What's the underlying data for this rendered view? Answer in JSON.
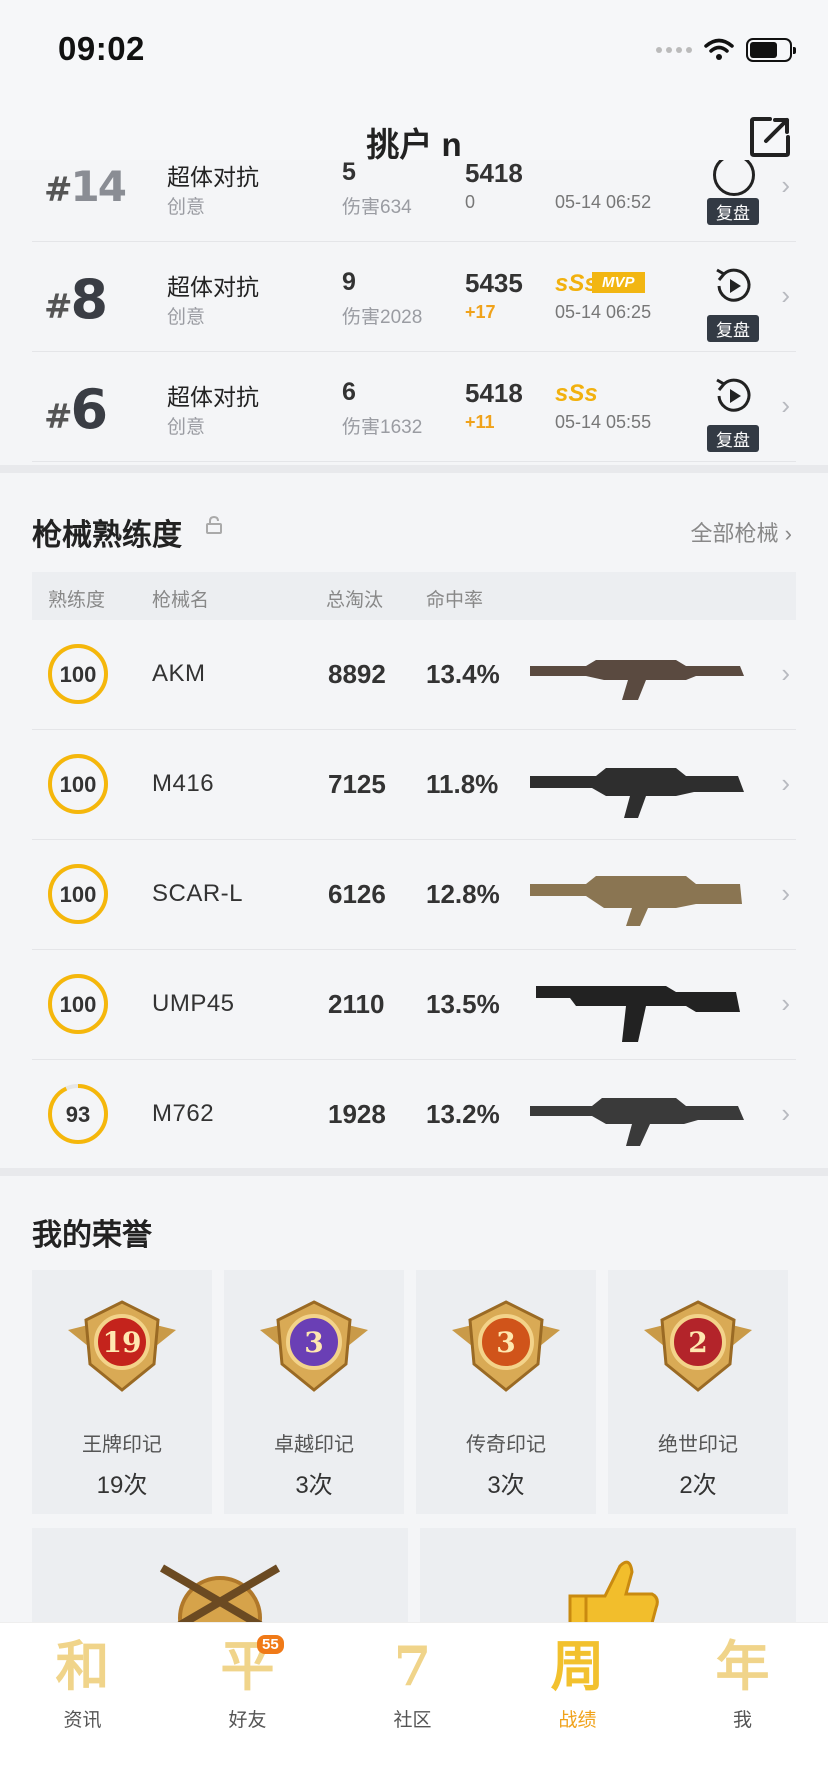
{
  "status_bar": {
    "time": "09:02"
  },
  "header": {
    "title": "挑户 n"
  },
  "matches": [
    {
      "rank": "14",
      "mode": "超体对抗",
      "sub": "创意",
      "kills": "5",
      "damage": "伤害634",
      "score": "5418",
      "delta": "0",
      "grade": "",
      "mvp": "",
      "time": "05-14 06:52",
      "replay_label": "复盘"
    },
    {
      "rank": "8",
      "mode": "超体对抗",
      "sub": "创意",
      "kills": "9",
      "damage": "伤害2028",
      "score": "5435",
      "delta": "+17",
      "grade": "sSs",
      "mvp": "MVP",
      "time": "05-14 06:25",
      "replay_label": "复盘"
    },
    {
      "rank": "6",
      "mode": "超体对抗",
      "sub": "创意",
      "kills": "6",
      "damage": "伤害1632",
      "score": "5418",
      "delta": "+11",
      "grade": "sSs",
      "mvp": "",
      "time": "05-14 05:55",
      "replay_label": "复盘"
    }
  ],
  "weapons_section": {
    "title": "枪械熟练度",
    "all_link": "全部枪械 ›",
    "columns": [
      "熟练度",
      "枪械名",
      "总淘汰",
      "命中率"
    ],
    "rows": [
      {
        "proficiency": "100",
        "progress": 1.0,
        "name": "AKM",
        "kills": "8892",
        "rate": "13.4%",
        "gun_icon": "rifle-akm-icon"
      },
      {
        "proficiency": "100",
        "progress": 1.0,
        "name": "M416",
        "kills": "7125",
        "rate": "11.8%",
        "gun_icon": "rifle-m416-icon"
      },
      {
        "proficiency": "100",
        "progress": 1.0,
        "name": "SCAR-L",
        "kills": "6126",
        "rate": "12.8%",
        "gun_icon": "rifle-scarl-icon"
      },
      {
        "proficiency": "100",
        "progress": 1.0,
        "name": "UMP45",
        "kills": "2110",
        "rate": "13.5%",
        "gun_icon": "smg-ump45-icon"
      },
      {
        "proficiency": "93",
        "progress": 0.93,
        "name": "M762",
        "kills": "1928",
        "rate": "13.2%",
        "gun_icon": "rifle-m762-icon"
      }
    ]
  },
  "honors": {
    "title": "我的荣誉",
    "items": [
      {
        "name": "王牌印记",
        "count": "19次",
        "level": "19",
        "color": "#c4231c"
      },
      {
        "name": "卓越印记",
        "count": "3次",
        "level": "3",
        "color": "#6a3fb5"
      },
      {
        "name": "传奇印记",
        "count": "3次",
        "level": "3",
        "color": "#d0541a"
      },
      {
        "name": "绝世印记",
        "count": "2次",
        "level": "2",
        "color": "#b3242a"
      }
    ]
  },
  "tabbar": {
    "items": [
      {
        "icon": "和",
        "label": "资讯"
      },
      {
        "icon": "平",
        "label": "好友",
        "badge": "55"
      },
      {
        "icon": "7",
        "label": "社区"
      },
      {
        "icon": "周",
        "label": "战绩",
        "active": true
      },
      {
        "icon": "年",
        "label": "我"
      }
    ]
  },
  "colors": {
    "accent": "#f2b10f",
    "ring": "#f5b70b",
    "mvp_bg": "#f2b612",
    "delta": "#f0a21a"
  }
}
